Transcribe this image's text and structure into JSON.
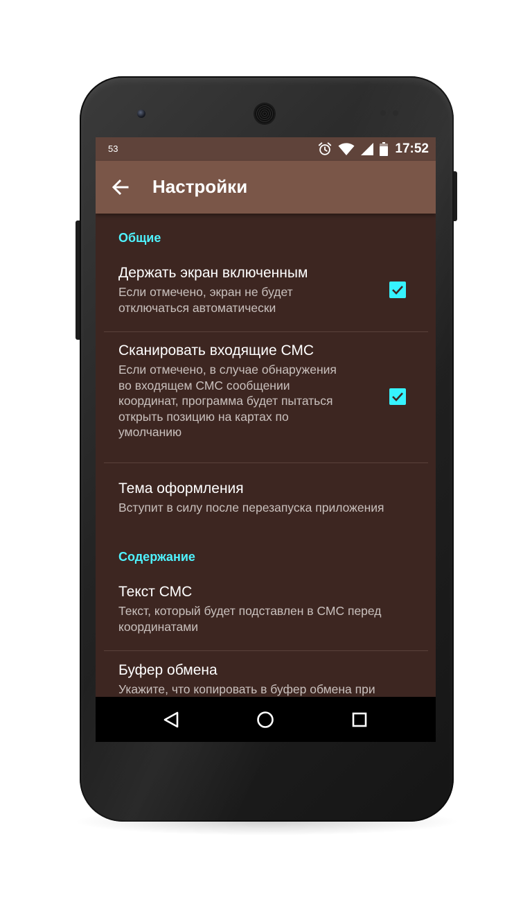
{
  "status_bar": {
    "notification_count": "53",
    "time": "17:52",
    "icons": [
      "alarm-icon",
      "wifi-icon",
      "signal-icon",
      "battery-icon"
    ]
  },
  "app_bar": {
    "title": "Настройки",
    "back_icon": "arrow-left-icon"
  },
  "sections": [
    {
      "header": "Общие",
      "items": [
        {
          "title": "Держать экран включенным",
          "summary": "Если отмечено, экран не будет\nотключаться автоматически",
          "checked": true
        },
        {
          "title": "Сканировать входящие СМС",
          "summary": "Если отмечено, в случае обнаружения\nво входящем СМС сообщении\nкоординат, программа будет пытаться\nоткрыть позицию на картах по\nумолчанию",
          "checked": true
        },
        {
          "title": "Тема оформления",
          "summary": "Вступит в силу после перезапуска приложения"
        }
      ]
    },
    {
      "header": "Содержание",
      "items": [
        {
          "title": "Текст СМС",
          "summary": "Текст, который будет подставлен в СМС перед\nкоординатами"
        },
        {
          "title": "Буфер обмена",
          "summary": "Укажите, что копировать в буфер обмена при"
        }
      ]
    }
  ],
  "nav_bar": {
    "icons": [
      "back-triangle-icon",
      "home-circle-icon",
      "recents-square-icon"
    ]
  },
  "colors": {
    "accent": "#36f3ff",
    "app_bar": "#7a5648",
    "status_bar": "#5f433a",
    "background": "#3d2621"
  }
}
